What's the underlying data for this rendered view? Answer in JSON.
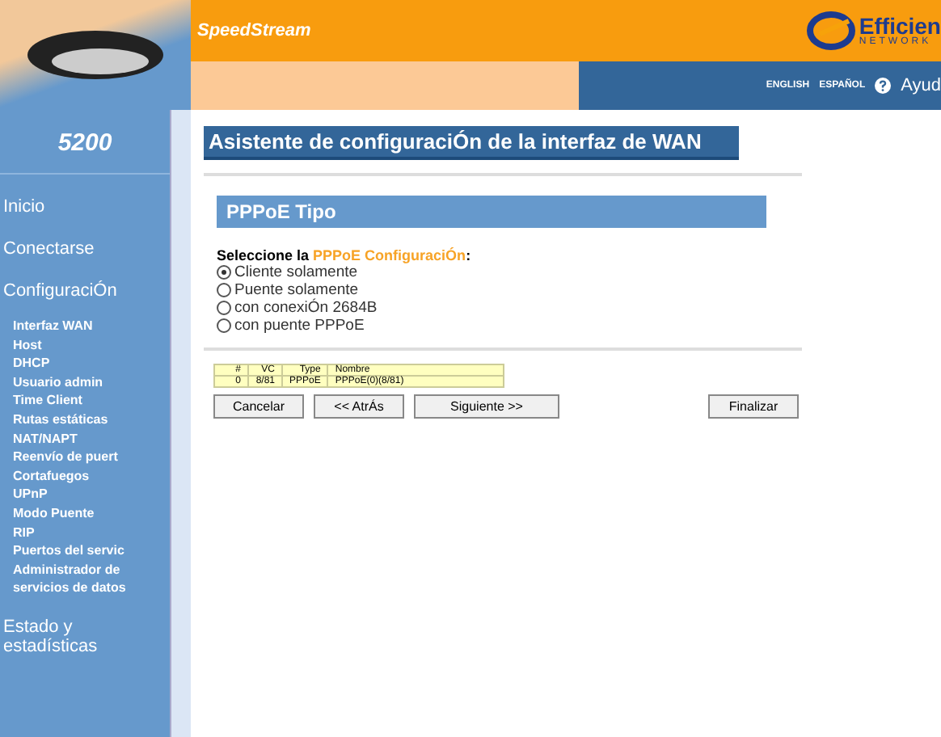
{
  "header": {
    "brand": "SpeedStream",
    "logo_text": "Efficien",
    "logo_subtext": "NETWORK",
    "links": [
      {
        "label": "ENGLISH"
      },
      {
        "label": "ESPAÑOL"
      }
    ],
    "help": "Ayud"
  },
  "sidebar": {
    "model": "5200",
    "items": [
      {
        "label": "Inicio"
      },
      {
        "label": "Conectarse"
      },
      {
        "label": "ConfiguraciÓn",
        "children": [
          {
            "label": "Interfaz WAN"
          },
          {
            "label": "Host"
          },
          {
            "label": "DHCP"
          },
          {
            "label": "Usuario admin"
          },
          {
            "label": "Time Client"
          },
          {
            "label": "Rutas estáticas"
          },
          {
            "label": "NAT/NAPT"
          },
          {
            "label": "Reenvío de puert"
          },
          {
            "label": "Cortafuegos"
          },
          {
            "label": "UPnP"
          },
          {
            "label": "Modo Puente"
          },
          {
            "label": "RIP"
          },
          {
            "label": "Puertos del servic"
          },
          {
            "label": "Administrador de servicios de datos"
          }
        ]
      },
      {
        "label": "Estado y estadísticas"
      }
    ]
  },
  "page": {
    "title": "Asistente de configuraciÓn de la interfaz de WAN",
    "section": "PPPoE Tipo",
    "prompt": "Seleccione la ",
    "prompt_highlight": "PPPoE ConfiguraciÓn",
    "prompt_end": ":",
    "options": [
      {
        "label": "Cliente solamente",
        "selected": true
      },
      {
        "label": "Puente solamente",
        "selected": false
      },
      {
        "label": "con conexiÓn 2684B",
        "selected": false
      },
      {
        "label": "con puente PPPoE",
        "selected": false
      }
    ],
    "table": {
      "columns": [
        "#",
        "VC",
        "Type",
        "Nombre"
      ],
      "rows": [
        [
          "0",
          "8/81",
          "PPPoE",
          "PPPoE(0)(8/81)"
        ]
      ]
    },
    "buttons": [
      {
        "label": "Cancelar"
      },
      {
        "label": "<< AtrÁs"
      },
      {
        "label": "Siguiente >>"
      },
      {
        "label": "Finalizar"
      }
    ]
  }
}
